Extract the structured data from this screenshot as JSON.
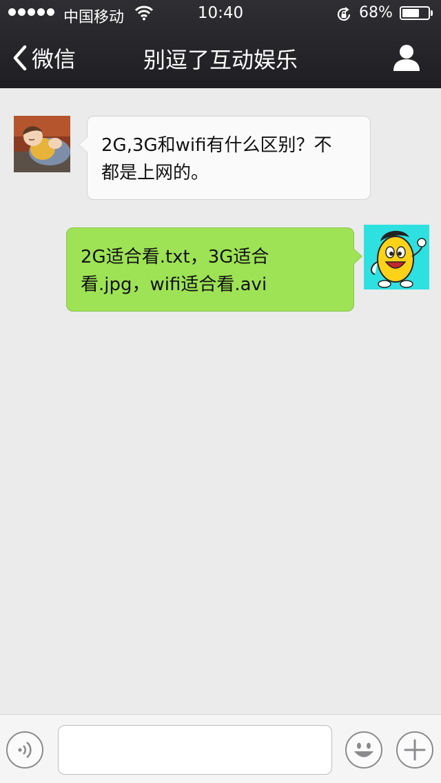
{
  "status_bar": {
    "carrier": "中国移动",
    "time": "10:40",
    "battery_percent": "68%",
    "battery_level": 0.68
  },
  "nav": {
    "back_label": "微信",
    "title": "别逗了互动娱乐",
    "back_icon": "chevron-left-icon",
    "profile_icon": "person-icon"
  },
  "messages": [
    {
      "direction": "incoming",
      "lines": [
        "2G,3G和wifi有什么区别？不",
        "都是上网的。"
      ]
    },
    {
      "direction": "outgoing",
      "lines": [
        "2G适合看.txt，3G适合",
        "看.jpg，wifi适合看.avi"
      ]
    }
  ],
  "input_bar": {
    "voice_icon": "voice-icon",
    "emoji_icon": "emoji-icon",
    "plus_icon": "plus-icon",
    "text_value": ""
  },
  "colors": {
    "nav_background": "#26262a",
    "chat_background": "#ebebeb",
    "incoming_bubble": "#fafafa",
    "outgoing_bubble": "#9ee355"
  }
}
